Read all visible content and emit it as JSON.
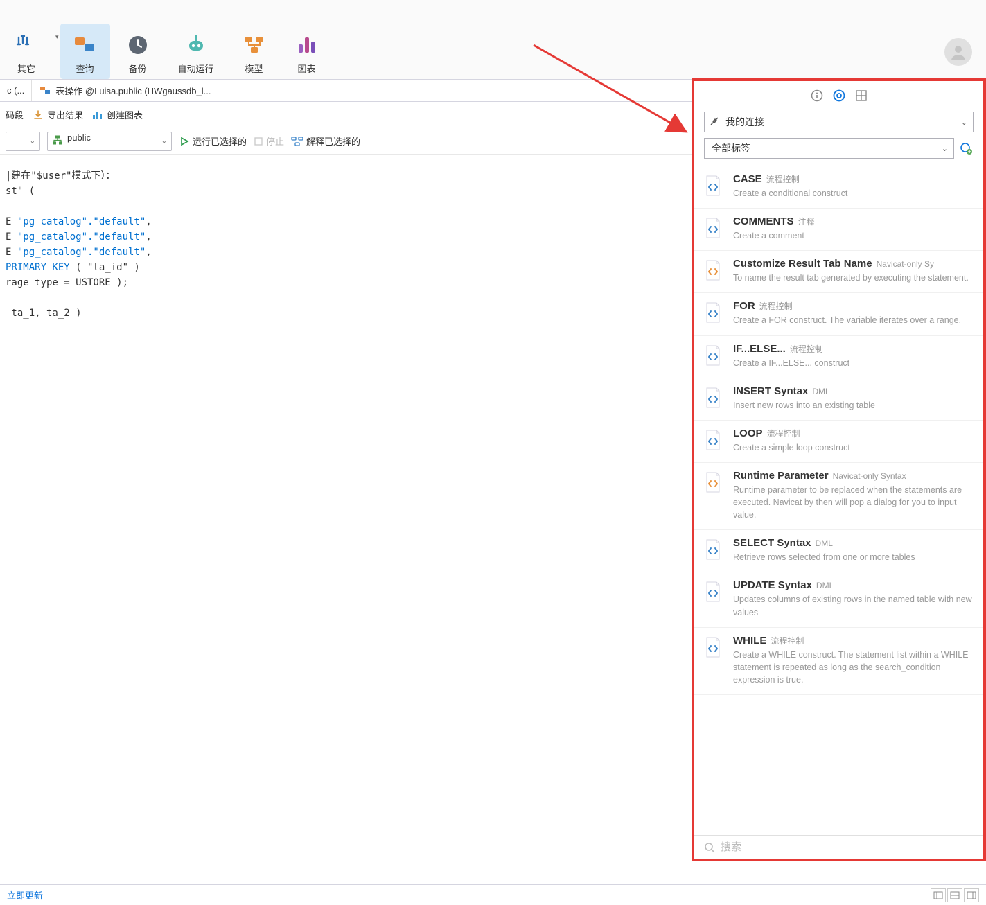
{
  "window": {
    "restore": "🗗",
    "close": "✕"
  },
  "toolbar": {
    "other": "其它",
    "query": "查询",
    "backup": "备份",
    "autorun": "自动运行",
    "model": "模型",
    "chart": "图表"
  },
  "tabs": {
    "tab1": "c (...",
    "tab2": "表操作 @Luisa.public (HWgaussdb_l..."
  },
  "actions": {
    "code": "码段",
    "export": "导出结果",
    "create_chart": "创建图表"
  },
  "schema": {
    "empty": "",
    "public": "public",
    "run_selected": "运行已选择的",
    "stop": "停止",
    "explain_selected": "解释已选择的"
  },
  "code": {
    "l1a": "|建在\"$user\"模式下）：",
    "l2": "st\" (",
    "l3a": "E ",
    "l3b": "\"pg_catalog\".\"default\"",
    "l3c": ",",
    "l4a": "E ",
    "l4b": "\"pg_catalog\".\"default\"",
    "l4c": ",",
    "l5a": "E ",
    "l5b": "\"pg_catalog\".\"default\"",
    "l5c": ",",
    "l6a": "PRIMARY KEY",
    "l6b": " ( \"ta_id\" )",
    "l7": "rage_type = USTORE );",
    "l8": " ta_1, ta_2 )"
  },
  "panel": {
    "conn_label": "我的连接",
    "tag_label": "全部标签",
    "search_placeholder": "搜索"
  },
  "snippets": [
    {
      "title": "CASE",
      "tag": "流程控制",
      "desc": "Create a conditional construct",
      "orange": false
    },
    {
      "title": "COMMENTS",
      "tag": "注释",
      "desc": "Create a comment",
      "orange": false
    },
    {
      "title": "Customize Result Tab Name",
      "tag": "Navicat-only Sy",
      "desc": "To name the result tab generated by executing the statement.",
      "orange": true
    },
    {
      "title": "FOR",
      "tag": "流程控制",
      "desc": "Create a FOR construct. The variable iterates over a range.",
      "orange": false
    },
    {
      "title": "IF...ELSE...",
      "tag": "流程控制",
      "desc": "Create a IF...ELSE... construct",
      "orange": false
    },
    {
      "title": "INSERT Syntax",
      "tag": "DML",
      "desc": "Insert new rows into an existing table",
      "orange": false
    },
    {
      "title": "LOOP",
      "tag": "流程控制",
      "desc": "Create a simple loop construct",
      "orange": false
    },
    {
      "title": "Runtime Parameter",
      "tag": "Navicat-only Syntax",
      "desc": "Runtime parameter to be replaced when the statements are executed. Navicat by then will pop a dialog for you to input value.",
      "orange": true
    },
    {
      "title": "SELECT Syntax",
      "tag": "DML",
      "desc": "Retrieve rows selected from one or more tables",
      "orange": false
    },
    {
      "title": "UPDATE Syntax",
      "tag": "DML",
      "desc": "Updates columns of existing rows in the named table with new values",
      "orange": false
    },
    {
      "title": "WHILE",
      "tag": "流程控制",
      "desc": "Create a WHILE construct. The statement list within a WHILE statement is repeated as long as the search_condition expression is true.",
      "orange": false
    }
  ],
  "status": {
    "update": "立即更新"
  }
}
